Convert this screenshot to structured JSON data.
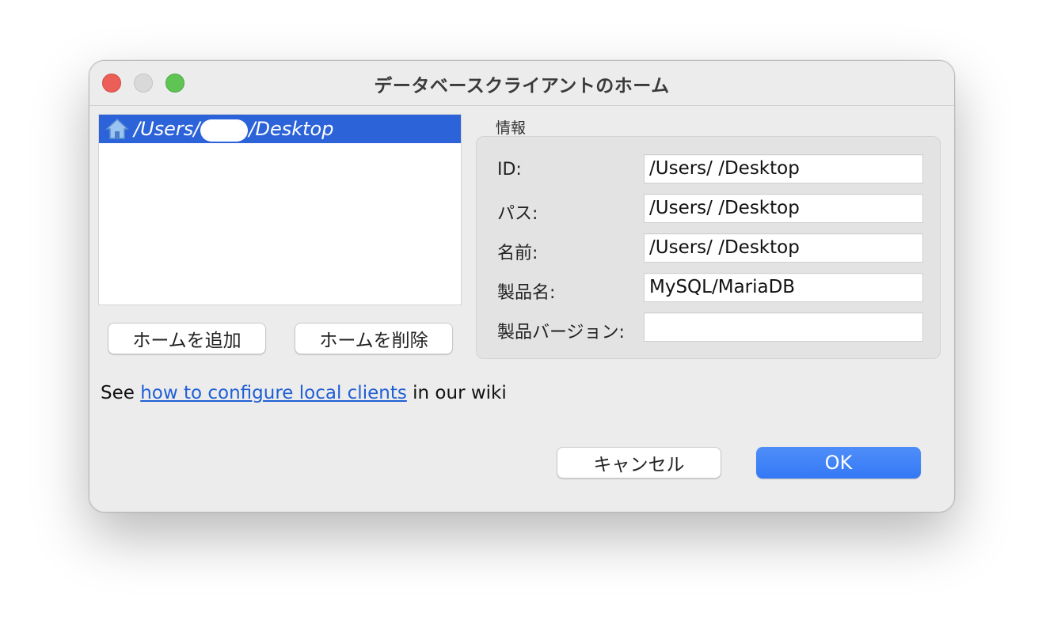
{
  "window": {
    "title": "データベースクライアントのホーム"
  },
  "home_list": {
    "items": [
      {
        "path_prefix": "/Users/",
        "path_suffix": "/Desktop",
        "icon": "home-icon",
        "selected": true
      }
    ]
  },
  "buttons": {
    "add_home": "ホームを追加",
    "remove_home": "ホームを削除",
    "cancel": "キャンセル",
    "ok": "OK"
  },
  "info": {
    "section_label": "情報",
    "rows": [
      {
        "label": "ID:",
        "value": "/Users/        /Desktop"
      },
      {
        "label": "パス:",
        "value": "/Users/        /Desktop"
      },
      {
        "label": "名前:",
        "value": "/Users/        /Desktop"
      },
      {
        "label": "製品名:",
        "value": "MySQL/MariaDB"
      },
      {
        "label": "製品バージョン:",
        "value": ""
      }
    ]
  },
  "footer": {
    "prefix": "See ",
    "link": "how to configure local clients",
    "suffix": " in our wiki"
  },
  "colors": {
    "selection": "#2c63d9",
    "ok_button": "#3478f6",
    "link": "#1f5fd6",
    "close": "#ec5f58",
    "minimize": "#d9d9d9",
    "maximize": "#5fc454"
  }
}
